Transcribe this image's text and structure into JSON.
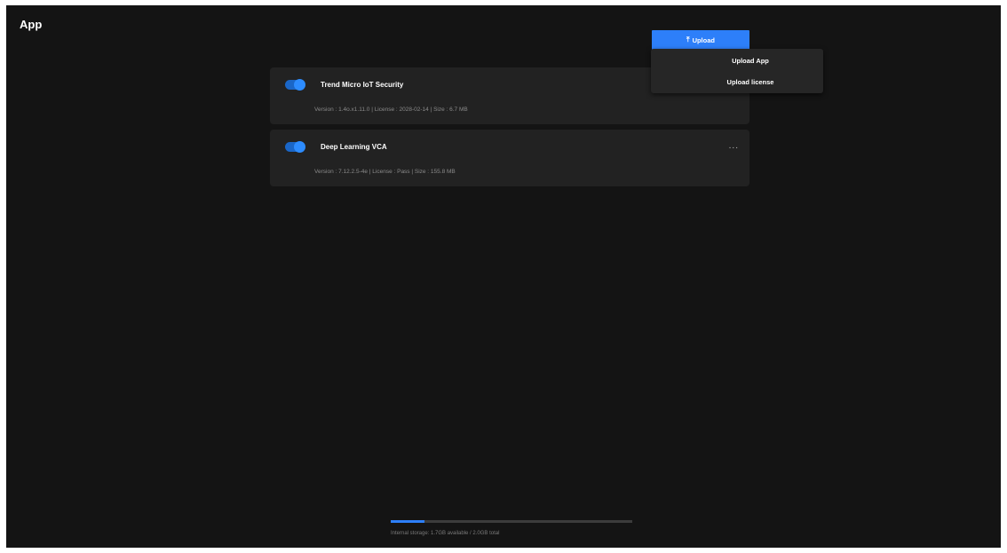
{
  "page": {
    "title": "App"
  },
  "apps": [
    {
      "name": "Trend Micro IoT Security",
      "meta": "Version : 1.4o.x1.11.0 | License : 2028-02-14 | Size : 6.7 MB",
      "enabled": true
    },
    {
      "name": "Deep Learning VCA",
      "meta": "Version : 7.12.2.5-4e | License : Pass | Size : 155.8 MB",
      "enabled": true,
      "more_label": "..."
    }
  ],
  "upload": {
    "icon": "upload-arrow-icon",
    "icon_glyph": "⤒",
    "label": "Upload",
    "menu": [
      "Upload App",
      "Upload license"
    ]
  },
  "storage": {
    "used_fraction": 0.14,
    "label": "Internal storage: 1.7GB available / 2.0GB total"
  },
  "colors": {
    "accent": "#2d7ff9",
    "background": "#141414",
    "card": "#222222"
  }
}
